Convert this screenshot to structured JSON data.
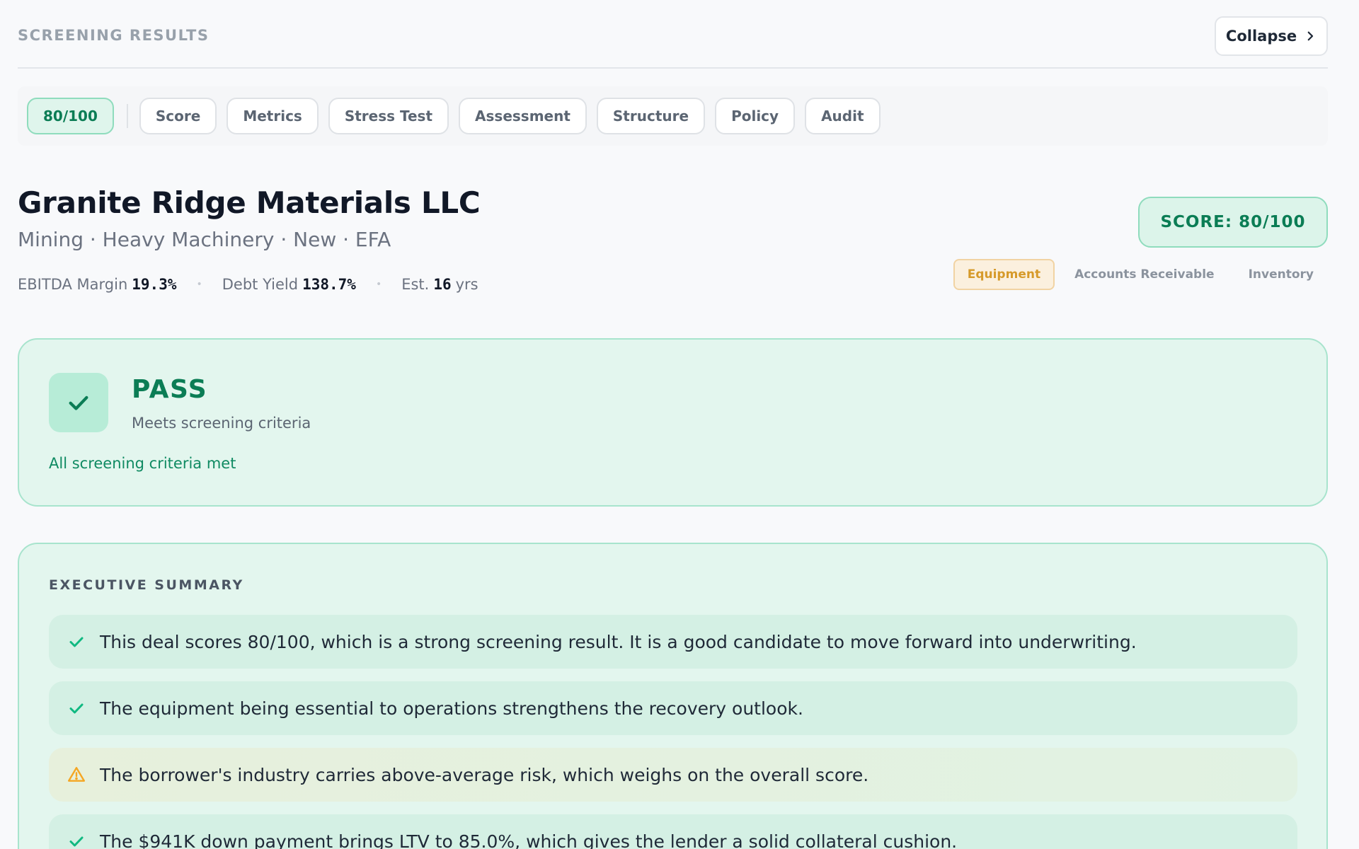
{
  "header": {
    "section_label": "SCREENING RESULTS",
    "collapse_label": "Collapse"
  },
  "tabs": {
    "score_badge": "80/100",
    "items": [
      {
        "label": "Score"
      },
      {
        "label": "Metrics"
      },
      {
        "label": "Stress Test"
      },
      {
        "label": "Assessment"
      },
      {
        "label": "Structure"
      },
      {
        "label": "Policy"
      },
      {
        "label": "Audit"
      }
    ]
  },
  "company": {
    "name": "Granite Ridge Materials LLC",
    "meta": "Mining · Heavy Machinery · New · EFA",
    "metrics": {
      "ebitda_label": "EBITDA Margin",
      "ebitda_value": "19.3%",
      "debt_yield_label": "Debt Yield",
      "debt_yield_value": "138.7%",
      "est_label": "Est.",
      "est_value": "16",
      "est_unit": "yrs",
      "separator": "•"
    }
  },
  "score_pill": "SCORE: 80/100",
  "asset_tabs": [
    {
      "label": "Equipment",
      "active": true
    },
    {
      "label": "Accounts Receivable",
      "active": false
    },
    {
      "label": "Inventory",
      "active": false
    }
  ],
  "result": {
    "status": "PASS",
    "subtitle": "Meets screening criteria",
    "note": "All screening criteria met"
  },
  "summary": {
    "title": "EXECUTIVE SUMMARY",
    "items": [
      {
        "type": "check",
        "text": "This deal scores 80/100, which is a strong screening result. It is a good candidate to move forward into underwriting."
      },
      {
        "type": "check",
        "text": "The equipment being essential to operations strengthens the recovery outlook."
      },
      {
        "type": "warning",
        "text": "The borrower's industry carries above-average risk, which weighs on the overall score."
      },
      {
        "type": "check",
        "text": "The $941K down payment brings LTV to 85.0%, which gives the lender a solid collateral cushion."
      }
    ]
  },
  "colors": {
    "pass_green": "#0b7d55",
    "check_green": "#10b981",
    "warning_amber": "#f5a623",
    "active_asset_amber": "#d69a2a"
  }
}
